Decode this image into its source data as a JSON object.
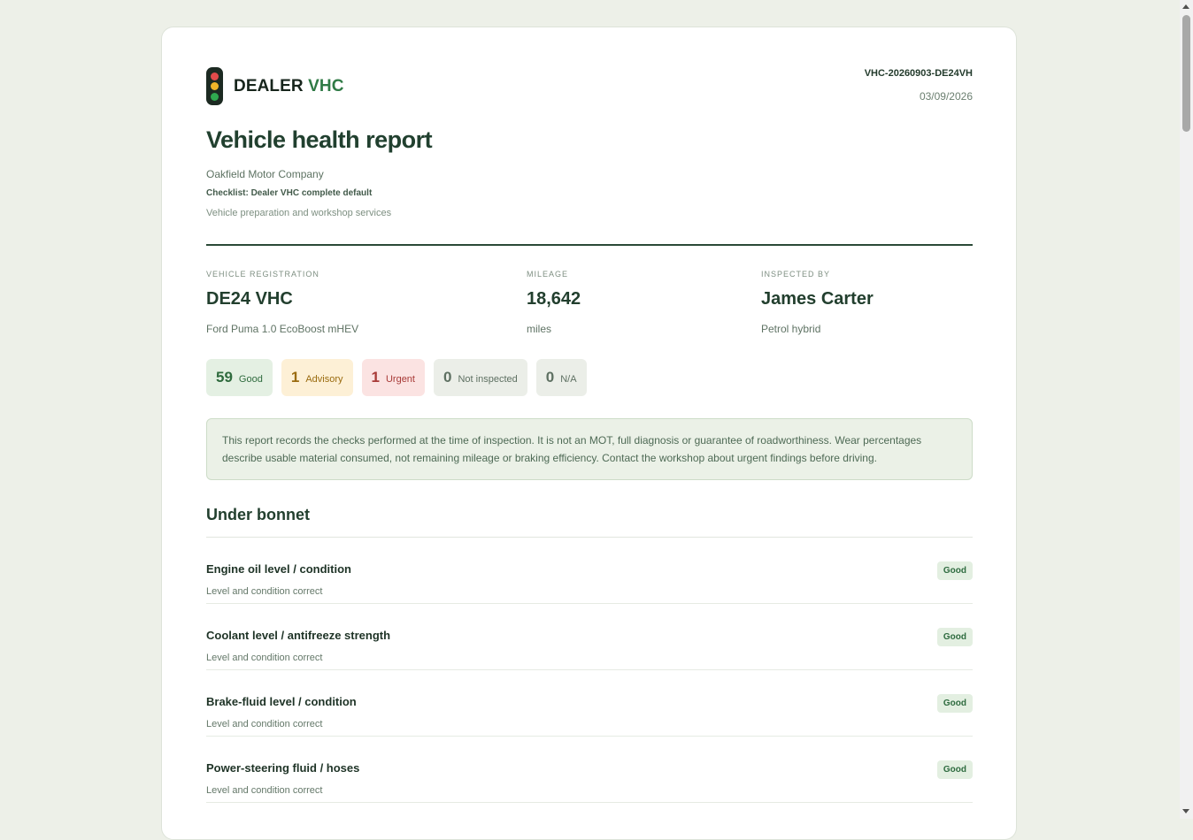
{
  "brand": {
    "name": "DEALER",
    "accent": "VHC",
    "lights": [
      "#e24b4b",
      "#f0b429",
      "#2fa84f"
    ]
  },
  "report": {
    "id": "VHC-20260903-DE24VH",
    "date": "03/09/2026",
    "title": "Vehicle health report",
    "company": "Oakfield Motor Company",
    "checklist": "Checklist: Dealer VHC complete default",
    "services": "Vehicle preparation and workshop services"
  },
  "vehicle": {
    "registration_label": "Vehicle registration",
    "registration": "DE24 VHC",
    "model": "Ford Puma 1.0 EcoBoost mHEV",
    "mileage_label": "Mileage",
    "mileage": "18,642",
    "mileage_unit": "miles",
    "inspector_label": "Inspected by",
    "inspector": "James Carter",
    "fuel": "Petrol hybrid"
  },
  "counts": [
    {
      "num": "59",
      "label": "Good",
      "bg": "#e4f0e3",
      "fg": "#2f6b3e"
    },
    {
      "num": "1",
      "label": "Advisory",
      "bg": "#fdf0d6",
      "fg": "#9a6b0f"
    },
    {
      "num": "1",
      "label": "Urgent",
      "bg": "#fbe3e2",
      "fg": "#a83a37"
    },
    {
      "num": "0",
      "label": "Not inspected",
      "bg": "#ebeee8",
      "fg": "#5e7062"
    },
    {
      "num": "0",
      "label": "N/A",
      "bg": "#ebeee8",
      "fg": "#5e7062"
    }
  ],
  "notice": "This report records the checks performed at the time of inspection. It is not an MOT, full diagnosis or guarantee of roadworthiness. Wear percentages describe usable material consumed, not remaining mileage or braking efficiency. Contact the workshop about urgent findings before driving.",
  "section": {
    "title": "Under bonnet",
    "items": [
      {
        "name": "Engine oil level / condition",
        "note": "Level and condition correct",
        "status": "Good"
      },
      {
        "name": "Coolant level / antifreeze strength",
        "note": "Level and condition correct",
        "status": "Good"
      },
      {
        "name": "Brake-fluid level / condition",
        "note": "Level and condition correct",
        "status": "Good"
      },
      {
        "name": "Power-steering fluid / hoses",
        "note": "Level and condition correct",
        "status": "Good"
      }
    ]
  }
}
